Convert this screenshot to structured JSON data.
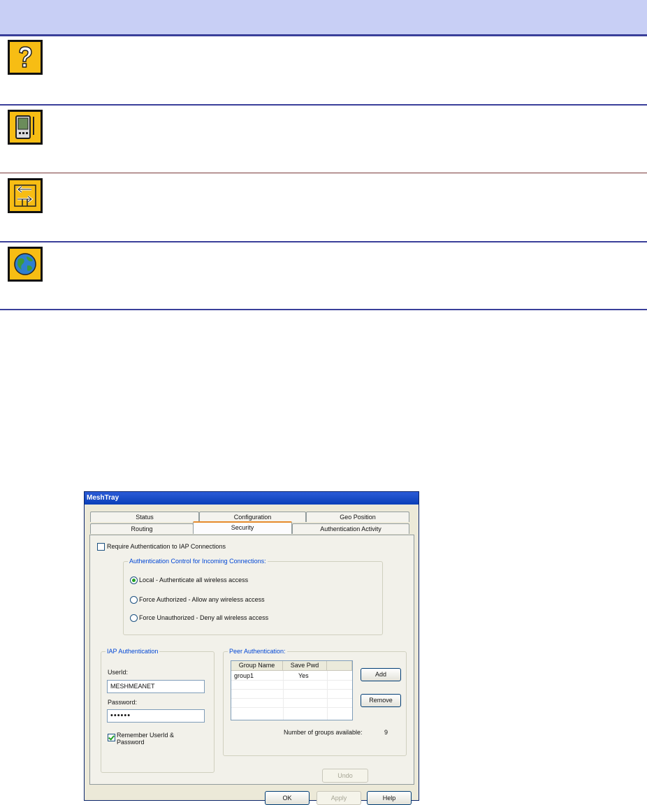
{
  "legend": {
    "rows": [
      {
        "icon": "help-question-icon"
      },
      {
        "icon": "pda-device-icon"
      },
      {
        "icon": "routing-arrows-icon"
      },
      {
        "icon": "globe-icon"
      }
    ]
  },
  "dialog": {
    "title": "MeshTray",
    "tabs_back": [
      "Status",
      "Configuration",
      "Geo Position"
    ],
    "tabs_front": [
      "Routing",
      "Security",
      "Authentication Activity"
    ],
    "active_tab": "Security",
    "require_auth_label": "Require Authentication to IAP Connections",
    "require_auth_checked": false,
    "auth_control": {
      "title": "Authentication Control for Incoming Connections:",
      "options": [
        {
          "label": "Local - Authenticate all wireless access",
          "checked": true
        },
        {
          "label": "Force Authorized - Allow any wireless access",
          "checked": false
        },
        {
          "label": "Force Unauthorized - Deny all wireless access",
          "checked": false
        }
      ]
    },
    "iap_auth": {
      "title": "IAP Authentication",
      "userid_label": "UserId:",
      "userid_value": "MESHMEANET",
      "password_label": "Password:",
      "password_value": "••••••",
      "remember_label_line1": "Remember UserId &",
      "remember_label_line2": "Password",
      "remember_checked": true
    },
    "peer_auth": {
      "title": "Peer Authentication:",
      "columns": [
        "Group Name",
        "Save Pwd"
      ],
      "rows": [
        [
          "group1",
          "Yes"
        ]
      ],
      "add_label": "Add",
      "remove_label": "Remove",
      "groups_available_label": "Number of groups available:",
      "groups_available_value": "9"
    },
    "undo_label": "Undo",
    "ok_label": "OK",
    "apply_label": "Apply",
    "help_label": "Help"
  }
}
